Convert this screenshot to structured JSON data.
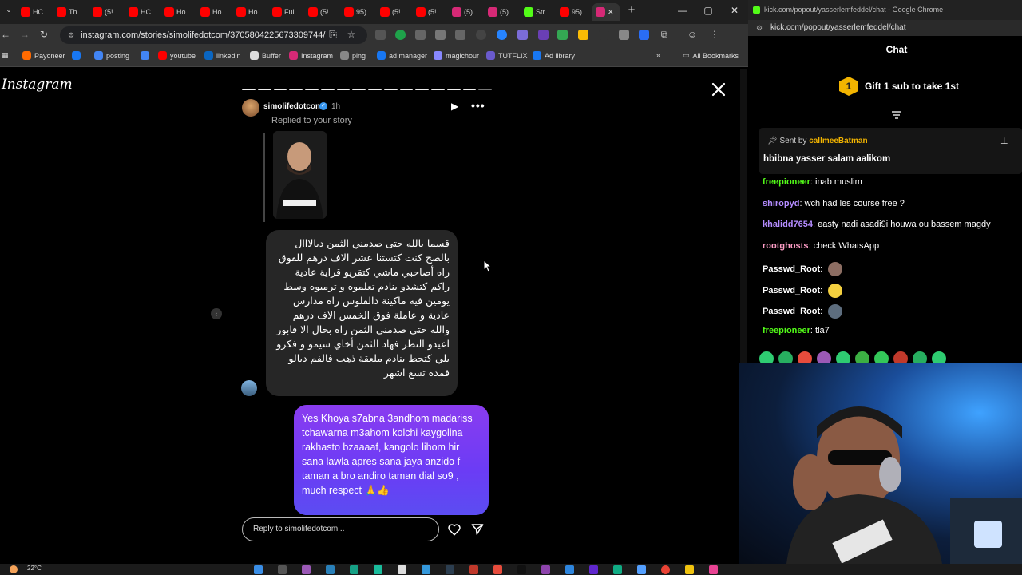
{
  "left_browser": {
    "tabs": [
      {
        "label": "HC",
        "color": "#ff0000"
      },
      {
        "label": "Th",
        "color": "#ff0000"
      },
      {
        "label": "(5!",
        "color": "#ff0000"
      },
      {
        "label": "HC",
        "color": "#ff0000"
      },
      {
        "label": "Ho",
        "color": "#ff0000"
      },
      {
        "label": "Ho",
        "color": "#ff0000"
      },
      {
        "label": "Ho",
        "color": "#ff0000"
      },
      {
        "label": "Ful",
        "color": "#ff0000"
      },
      {
        "label": "(5!",
        "color": "#ff0000"
      },
      {
        "label": "95)",
        "color": "#ff0000"
      },
      {
        "label": "(5!",
        "color": "#ff0000"
      },
      {
        "label": "(5!",
        "color": "#ff0000"
      },
      {
        "label": "(5)",
        "color": "#d62976"
      },
      {
        "label": "(5)",
        "color": "#d62976"
      },
      {
        "label": "Str",
        "color": "#53fc18"
      },
      {
        "label": "95)",
        "color": "#ff0000"
      }
    ],
    "url": "instagram.com/stories/simolifedotcom/3705804225673309744/",
    "bookmarks": [
      {
        "label": "Payoneer",
        "color": "#ff6a00"
      },
      {
        "label": "",
        "color": "#1877f2"
      },
      {
        "label": "posting",
        "color": "#4285f4"
      },
      {
        "label": "",
        "color": "#4285f4"
      },
      {
        "label": "youtube",
        "color": "#ff0000"
      },
      {
        "label": "linkedin",
        "color": "#0a66c2"
      },
      {
        "label": "Buffer",
        "color": "#dddddd"
      },
      {
        "label": "Instagram",
        "color": "#d62976"
      },
      {
        "label": "ping",
        "color": "#888888"
      },
      {
        "label": "ad manager",
        "color": "#1877f2"
      },
      {
        "label": "magichour",
        "color": "#8888ff"
      },
      {
        "label": "TUTFLIX",
        "color": "#6a5acd"
      },
      {
        "label": "Ad library",
        "color": "#1877f2"
      }
    ],
    "all_bookmarks": "All Bookmarks"
  },
  "instagram": {
    "logo": "Instagram",
    "story": {
      "username": "simolifedotcom",
      "time": "1h",
      "replied_label": "Replied to your story",
      "arabic_message": "قسما بالله حتى صدمني الثمن ديالااال بالصح كنت كتستنا عشر الاف درهم للفوق راه أصاحبي ماشي كتقريو قراية عادية راكم كتشدو بنادم تعلموه و ترميوه وسط يومين فيه ماكينة دالفلوس راه مدارس عادية و عاملة فوق الخمس الاف درهم والله حتى صدمني الثمن راه بحال الا فابور اعيدو النظر فهاد الثمن أخاي سيمو و فكرو بلي كتحط بنادم ملعقة ذهب فالفم ديالو فمدة تسع اشهر",
      "english_message": "Yes Khoya s7abna 3andhom madariss tchawarna m3ahom kolchi kaygolina rakhasto bzaaaaf, kangolo lihom hir sana lawla apres sana jaya anzido f taman a bro andiro taman dial so9 , much respect 🙏👍",
      "reply_placeholder": "Reply to simolifedotcom..."
    }
  },
  "right_browser": {
    "window_title": "kick.com/popout/yasserlemfeddel/chat - Google Chrome",
    "url": "kick.com/popout/yasserlemfeddel/chat",
    "chat_title": "Chat",
    "gift_badge": "1",
    "gift_text": "Gift 1 sub to take 1st",
    "pinned_prefix": "Sent by",
    "pinned_user": "callmeeBatman",
    "pinned_text": "hbibna yasser salam aalikom",
    "messages": [
      {
        "user": "freepioneer",
        "color": "#53fc18",
        "text": "inab muslim"
      },
      {
        "user": "shiropyd",
        "color": "#b48cff",
        "text": "wch had les course free ?"
      },
      {
        "user": "khalidd7654",
        "color": "#b48cff",
        "text": "easty nadi asadi9i houwa ou bassem magdy"
      },
      {
        "user": "rootghosts",
        "color": "#ff9ec7",
        "text": "check WhatsApp"
      },
      {
        "user": "Passwd_Root",
        "color": "#ffffff",
        "text": ""
      },
      {
        "user": "Passwd_Root",
        "color": "#ffffff",
        "text": ""
      },
      {
        "user": "Passwd_Root",
        "color": "#ffffff",
        "text": ""
      },
      {
        "user": "freepioneer",
        "color": "#53fc18",
        "text": "tla7"
      }
    ]
  },
  "taskbar": {
    "weather": "22°C"
  },
  "colors": {
    "accent_kick": "#53fc18",
    "ig_bubble_start": "#8a3cf0",
    "ig_bubble_end": "#5b4df2",
    "gift_gold": "#f2b400"
  }
}
